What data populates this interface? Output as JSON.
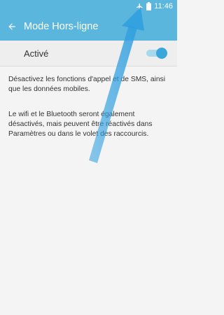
{
  "status_bar": {
    "time": "11:46",
    "icons": [
      "airplane-icon",
      "battery-icon"
    ]
  },
  "app_bar": {
    "title": "Mode Hors-ligne",
    "back_icon": "back-arrow-icon"
  },
  "switch_row": {
    "label": "Activé",
    "enabled": true
  },
  "description": {
    "para1": "Désactivez les fonctions d'appel et de SMS, ainsi que les données mobiles.",
    "para2": "Le wifi et le Bluetooth seront également désactivés, mais peuvent être réactivés dans Paramètres ou dans le volet des raccourcis."
  },
  "colors": {
    "accent": "#5ab6dc",
    "toggle_on": "#3aa6d9",
    "arrow": "#2f9fe0"
  }
}
